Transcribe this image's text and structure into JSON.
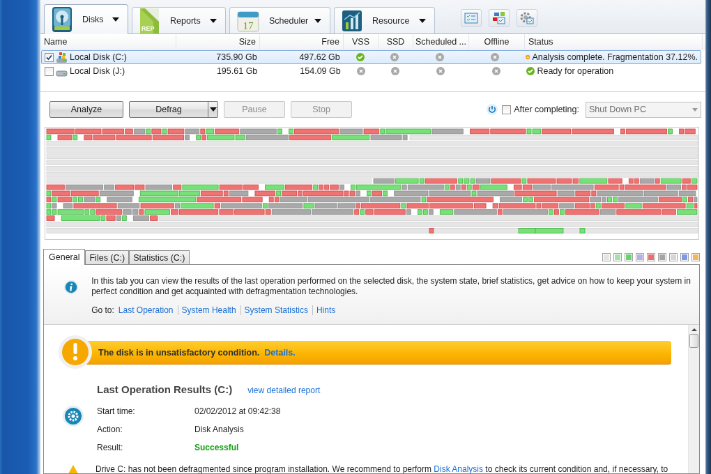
{
  "tabs": [
    {
      "label": "Disks",
      "selected": true
    },
    {
      "label": "Reports",
      "icon_text": "REP",
      "selected": false
    },
    {
      "label": "Scheduler",
      "icon_text": "17",
      "selected": false
    },
    {
      "label": "Resource",
      "selected": false
    }
  ],
  "disk_table": {
    "columns": [
      "Name",
      "Size",
      "Free",
      "VSS",
      "SSD",
      "Scheduled ...",
      "Offline",
      "Status"
    ],
    "rows": [
      {
        "name": "Local Disk (C:)",
        "size": "735.90 Gb",
        "free": "497.62 Gb",
        "vss": true,
        "ssd": false,
        "scheduled": false,
        "offline": false,
        "status": {
          "kind": "warning",
          "text": "Analysis complete. Fragmentation 37.12%."
        },
        "checked": true,
        "selected": true
      },
      {
        "name": "Local Disk (J:)",
        "size": "195.61 Gb",
        "free": "154.09 Gb",
        "vss": false,
        "ssd": false,
        "scheduled": false,
        "offline": false,
        "status": {
          "kind": "ok",
          "text": "Ready for operation"
        },
        "checked": false,
        "selected": false
      }
    ]
  },
  "actions": {
    "buttons": [
      {
        "label": "Analyze",
        "kind": "plain",
        "disabled": false
      },
      {
        "label": "Defrag",
        "kind": "split",
        "disabled": false
      },
      {
        "label": "Pause",
        "kind": "plain",
        "disabled": true
      },
      {
        "label": "Stop",
        "kind": "plain",
        "disabled": true
      }
    ],
    "after_completing": {
      "label": "After completing:",
      "checked": false
    },
    "shutdown_select": {
      "value": "Shut Down PC",
      "disabled": true
    }
  },
  "bottom_tabs": [
    {
      "label": "General",
      "selected": true
    },
    {
      "label": "Files (C:)",
      "selected": false
    },
    {
      "label": "Statistics (C:)",
      "selected": false
    }
  ],
  "legend": [
    {
      "color": "#e4e4e4"
    },
    {
      "color": "#a6e0a6"
    },
    {
      "color": "#6ad26a"
    },
    {
      "color": "#b9aee6"
    },
    {
      "color": "#e86e6e"
    },
    {
      "color": "#a4a4a4"
    },
    {
      "color": "#d6d6d6"
    },
    {
      "color": "#7c9ae8"
    },
    {
      "color": "#f4b45c"
    }
  ],
  "info": {
    "text": "In this tab you can view the results of the last operation performed on the selected disk, the system state, brief statistics, get advice on how to keep your system in perfect condition and get acquainted with defragmentation technologies.",
    "goto_label": "Go to:",
    "links": [
      "Last Operation",
      "System Health",
      "System Statistics",
      "Hints"
    ]
  },
  "alert": {
    "text": "The disk is in unsatisfactory condition.",
    "link": "Details."
  },
  "results": {
    "title": "Last Operation Results (C:)",
    "link": "view detailed report",
    "fields": [
      {
        "label": "Start time:",
        "value": "02/02/2012 at 09:42:38",
        "kind": "plain"
      },
      {
        "label": "Action:",
        "value": "Disk Analysis",
        "kind": "plain"
      },
      {
        "label": "Result:",
        "value": "Successful",
        "kind": "success"
      }
    ]
  },
  "notice": {
    "text_before": "Drive C: has not been defragmented since program installation. We recommend to perform ",
    "link": "Disk Analysis",
    "text_after": " to check its current condition and, if necessary, to"
  }
}
